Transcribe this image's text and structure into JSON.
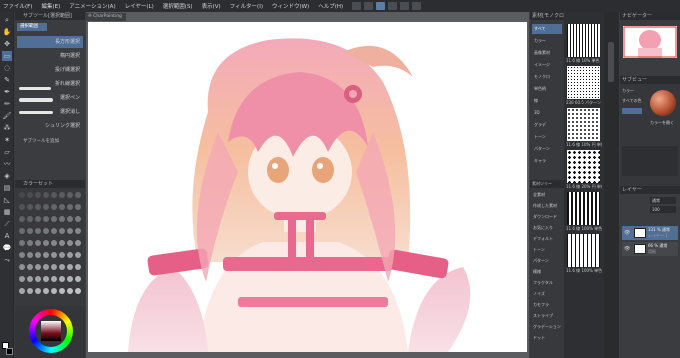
{
  "menu": {
    "items": [
      "ファイル(F)",
      "編集(E)",
      "アニメーション(A)",
      "レイヤー(L)",
      "選択範囲(S)",
      "表示(V)",
      "フィルター(I)",
      "ウィンドウ(W)",
      "ヘルプ(H)"
    ]
  },
  "toolbar": {
    "icons": [
      "zoom-icon",
      "hand-icon",
      "move-icon",
      "select-icon",
      "lasso-icon",
      "eyedropper-icon",
      "pen-icon",
      "pencil-icon",
      "brush-icon",
      "airbrush-icon",
      "decoration-icon",
      "eraser-icon",
      "blend-icon",
      "fill-icon",
      "gradient-icon",
      "figure-icon",
      "frame-icon",
      "ruler-icon",
      "text-icon",
      "balloon-icon",
      "correct-line-icon"
    ]
  },
  "subtool": {
    "header": "サブツール[選択範囲]",
    "tab": "選択範囲",
    "items": [
      "長方形選択",
      "楕円選択",
      "投げ縄選択",
      "折れ線選択",
      "選択ペン",
      "選択消し",
      "シュリンク選択"
    ],
    "footer": "サブツールを追加"
  },
  "swatch": {
    "header": "カラーセット"
  },
  "document": {
    "tab": "※ CharPainting"
  },
  "materials": {
    "header": "素材[モノクロパターン]",
    "categories": [
      "すべて",
      "カラー",
      "画像素材",
      "イメージ",
      "モノクロ",
      "単色柄",
      "線",
      "3D",
      "グラデ",
      "トーン",
      "パターン",
      "キャラ"
    ],
    "thumbs": [
      {
        "label": "11.6 線 10% 単色"
      },
      {
        "label": "236 60.5 パターン 単色"
      },
      {
        "label": "11.6 線 10% 円 単色"
      },
      {
        "label": "11.6 線 20% 円 単色"
      },
      {
        "label": "11.6 線 100% 単色"
      },
      {
        "label": "11.6 線 100% 単色"
      }
    ],
    "subheader": "素材ツリー",
    "tree": [
      "全素材",
      "作成した素材",
      "ダウンロード",
      "お気に入り",
      "デフォルト",
      "トーン",
      "パターン",
      "模様",
      "フラクタル",
      "ノイズ",
      "カモフラ",
      "ストライプ",
      "グラデーション",
      "ドット"
    ]
  },
  "navigator": {
    "header": "ナビゲーター"
  },
  "color": {
    "header": "サブビュー",
    "labels": [
      "カラー",
      "すべての色",
      "カラーを開く"
    ],
    "swatch_color": "#b45030"
  },
  "layers": {
    "header": "レイヤー",
    "mode": "通常",
    "opacity": "100",
    "items": [
      {
        "name": "131 % 通常",
        "sub": "レイヤー 1"
      },
      {
        "name": "66 % 通常",
        "sub": "用紙"
      }
    ]
  },
  "colors": {
    "accent": "#4f6f96",
    "panel": "#3a3c3f",
    "menubar": "#2c2d30"
  }
}
